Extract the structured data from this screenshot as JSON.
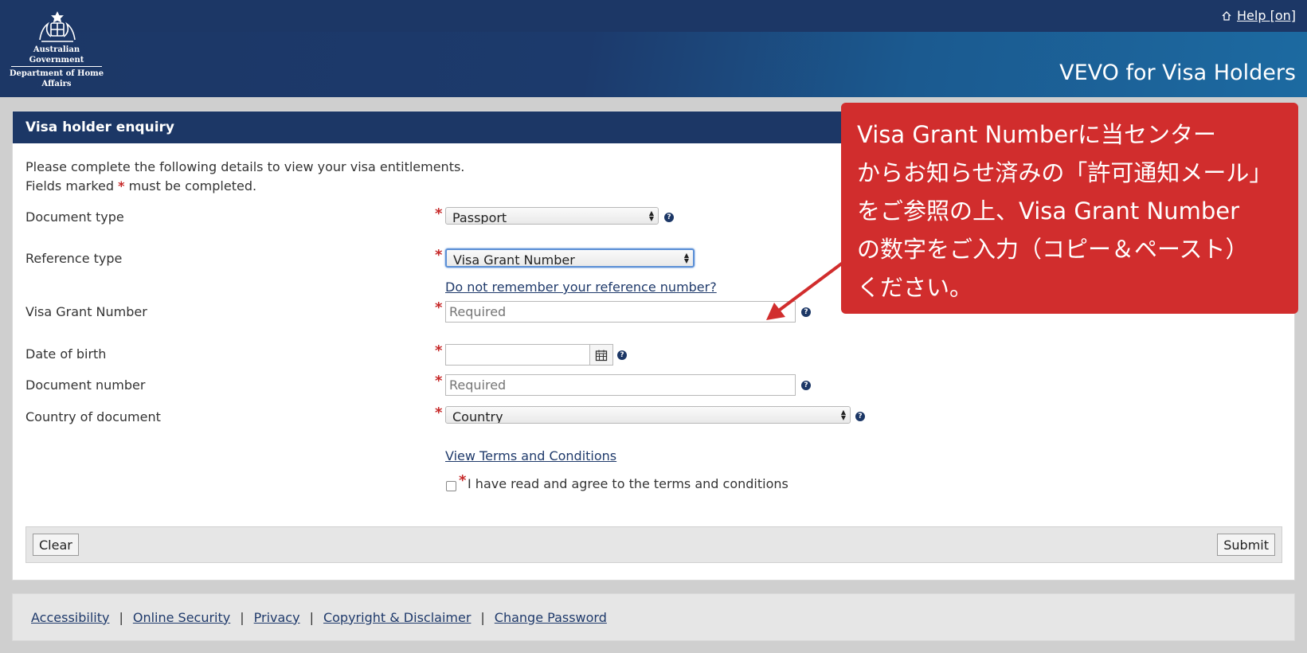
{
  "header": {
    "gov_line1": "Australian Government",
    "gov_line2": "Department of Home Affairs",
    "help_label": "Help [on]",
    "app_title": "VEVO for Visa Holders"
  },
  "panel": {
    "title": "Visa holder enquiry",
    "intro_line1": "Please complete the following details to view your visa entitlements.",
    "intro_line2_a": "Fields marked",
    "required_mark": "*",
    "intro_line2_b": "must be completed."
  },
  "form": {
    "document_type": {
      "label": "Document type",
      "value": "Passport"
    },
    "reference_type": {
      "label": "Reference type",
      "value": "Visa Grant Number"
    },
    "forgot_reference_link": "Do not remember your reference number?",
    "visa_grant_number": {
      "label": "Visa Grant Number",
      "placeholder": "Required"
    },
    "date_of_birth": {
      "label": "Date of birth"
    },
    "document_number": {
      "label": "Document number",
      "placeholder": "Required"
    },
    "country_of_document": {
      "label": "Country of document",
      "value": "Country"
    },
    "terms_link": "View Terms and Conditions",
    "agree_label": "I have read and agree to the terms and conditions",
    "help_mark": "?"
  },
  "buttons": {
    "clear": "Clear",
    "submit": "Submit"
  },
  "callout": {
    "lines": [
      "Visa Grant Numberに当センター",
      "からお知らせ済みの「許可通知メール」",
      "をご参照の上、Visa Grant Number",
      "の数字をご入力（コピー＆ペースト）",
      "ください。"
    ]
  },
  "footer": {
    "links": [
      "Accessibility",
      "Online Security",
      "Privacy",
      "Copyright & Disclaimer",
      "Change Password"
    ]
  },
  "colors": {
    "header_navy": "#1c3766",
    "callout_red": "#d12d2d",
    "required_red": "#c62828",
    "link_blue": "#1f3a6b"
  }
}
